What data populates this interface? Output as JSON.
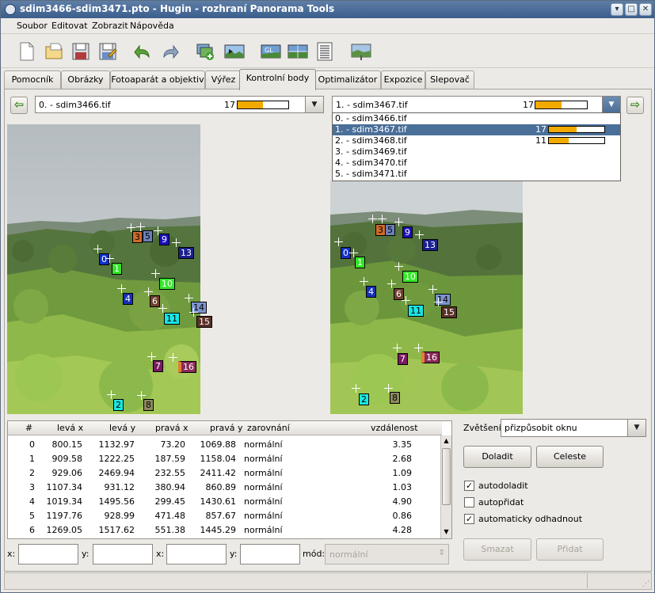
{
  "window": {
    "title": "sdim3466-sdim3471.pto - Hugin - rozhraní Panorama Tools",
    "minimize": "▾",
    "maximize": "□",
    "close": "✕"
  },
  "menu": [
    "Soubor",
    "Editovat",
    "Zobrazit",
    "Nápověda"
  ],
  "toolbar": [
    "new-file-icon",
    "open-file-icon",
    "save-icon",
    "save-as-icon",
    "undo-icon",
    "redo-icon",
    "add-images-icon",
    "align-icon",
    "opengl-preview-icon",
    "preview-icon",
    "optimizer-list-icon",
    "stitch-icon"
  ],
  "tabs": [
    "Pomocník",
    "Obrázky",
    "Fotoaparát a objektiv",
    "Výřez",
    "Kontrolní body",
    "Optimalizátor",
    "Expozice",
    "Slepovač"
  ],
  "active_tab": "Kontrolní body",
  "left_image": {
    "label": "0. - sdim3466.tif",
    "count": "17",
    "bar": 0.5
  },
  "right_image": {
    "label": "1. - sdim3467.tif",
    "count": "17",
    "bar": 0.5
  },
  "dropdown": [
    {
      "label": "0. - sdim3466.tif"
    },
    {
      "label": "1. - sdim3467.tif",
      "count": "17",
      "bar": 0.5
    },
    {
      "label": "2. - sdim3468.tif",
      "count": "11",
      "bar": 0.35
    },
    {
      "label": "3. - sdim3469.tif"
    },
    {
      "label": "4. - sdim3470.tif"
    },
    {
      "label": "5. - sdim3471.tif"
    }
  ],
  "table": {
    "headers": [
      "#",
      "levá x",
      "levá y",
      "pravá x",
      "pravá y",
      "zarovnání",
      "vzdálenost"
    ],
    "rows": [
      [
        "0",
        "800.15",
        "1132.97",
        "73.20",
        "1069.88",
        "normální",
        "3.35"
      ],
      [
        "1",
        "909.58",
        "1222.25",
        "187.59",
        "1158.04",
        "normální",
        "2.68"
      ],
      [
        "2",
        "929.06",
        "2469.94",
        "232.55",
        "2411.42",
        "normální",
        "1.09"
      ],
      [
        "3",
        "1107.34",
        "931.12",
        "380.94",
        "860.89",
        "normální",
        "1.03"
      ],
      [
        "4",
        "1019.34",
        "1495.56",
        "299.45",
        "1430.61",
        "normální",
        "4.90"
      ],
      [
        "5",
        "1197.76",
        "928.99",
        "471.48",
        "857.67",
        "normální",
        "0.86"
      ],
      [
        "6",
        "1269.05",
        "1517.62",
        "551.38",
        "1445.29",
        "normální",
        "4.28"
      ]
    ]
  },
  "zoom": {
    "label": "Zvětšení:",
    "value": "přizpůsobit oknu"
  },
  "buttons": {
    "fine_tune": "Doladit",
    "celeste": "Celeste",
    "delete": "Smazat",
    "add": "Přidat"
  },
  "checkboxes": [
    {
      "label": "autodoladit",
      "checked": true
    },
    {
      "label": "autopřidat",
      "checked": false
    },
    {
      "label": "automaticky odhadnout",
      "checked": true
    }
  ],
  "coords": {
    "x1": "x:",
    "y1": "y:",
    "x2": "x:",
    "y2": "y:",
    "mode_label": "mód:",
    "mode_value": "normální"
  }
}
